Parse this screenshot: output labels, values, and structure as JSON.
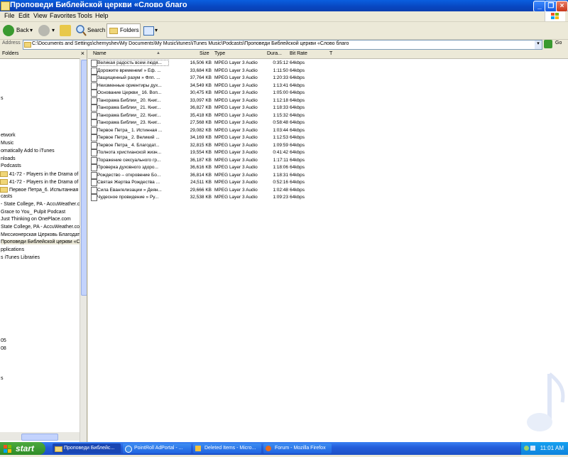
{
  "window": {
    "title": "Проповеди Библейской церкви «Слово благо"
  },
  "menu": [
    "File",
    "Edit",
    "View",
    "Favorites",
    "Tools",
    "Help"
  ],
  "toolbar": {
    "back": "Back",
    "search": "Search",
    "folders": "Folders"
  },
  "address": {
    "label": "Address",
    "path": "C:\\Documents and Settings\\chernyshev\\My Documents\\My Music\\itunes\\iTunes Music\\Podcasts\\Проповеди Библейской церкви «Слово благо",
    "go": "Go"
  },
  "folders_pane": {
    "title": "Folders",
    "items": [
      {
        "label": "s",
        "folder": false
      },
      {
        "label": "etwork",
        "folder": false
      },
      {
        "label": "Music",
        "folder": false
      },
      {
        "label": "omatically Add to iTunes",
        "folder": false
      },
      {
        "label": "nloads",
        "folder": false
      },
      {
        "label": "Podcasts",
        "folder": false
      },
      {
        "label": "41-72 - Players in the Drama of t",
        "folder": true
      },
      {
        "label": "41-72 - Players in the Drama of t",
        "folder": true
      },
      {
        "label": "Первое Петра_6. Испытанная",
        "folder": true
      },
      {
        "label": "casts",
        "folder": false
      },
      {
        "label": "- State College, PA - AccuWeather.co",
        "folder": false
      },
      {
        "label": "Grace to You_ Pulpit Podcast",
        "folder": false
      },
      {
        "label": "Just Thinking on OnePlace.com",
        "folder": false
      },
      {
        "label": "State College, PA - AccuWeather.com",
        "folder": false
      },
      {
        "label": "Миссионерская Церковь Благодат",
        "folder": false
      },
      {
        "label": "Проповеди Библейской церкви «Сл",
        "folder": false
      },
      {
        "label": "pplications",
        "folder": false
      },
      {
        "label": "s iTunes Libraries",
        "folder": false
      },
      {
        "label": "05",
        "folder": false
      },
      {
        "label": "08",
        "folder": false
      },
      {
        "label": "s",
        "folder": false
      }
    ]
  },
  "columns": [
    "Name",
    "Size",
    "Type",
    "Dura...",
    "Bit Rate",
    "T"
  ],
  "files": [
    {
      "name": "Великая радость всем людя...",
      "size": "16,506 KB",
      "type": "MPEG Layer 3 Audio",
      "duration": "0:35:12",
      "bitrate": "64kbps"
    },
    {
      "name": "Дорожите временем! » Еф. ...",
      "size": "33,684 KB",
      "type": "MPEG Layer 3 Audio",
      "duration": "1:11:50",
      "bitrate": "64kbps"
    },
    {
      "name": "Защищенный разум » Флп. ...",
      "size": "37,764 KB",
      "type": "MPEG Layer 3 Audio",
      "duration": "1:20:33",
      "bitrate": "64kbps"
    },
    {
      "name": "Неизменные ориентиры дух...",
      "size": "34,549 KB",
      "type": "MPEG Layer 3 Audio",
      "duration": "1:13:41",
      "bitrate": "64kbps"
    },
    {
      "name": "Основание Церкви_ 16. Воп...",
      "size": "30,475 KB",
      "type": "MPEG Layer 3 Audio",
      "duration": "1:05:00",
      "bitrate": "64kbps"
    },
    {
      "name": "Панорама Библии_ 20. Книг...",
      "size": "33,097 KB",
      "type": "MPEG Layer 3 Audio",
      "duration": "1:12:18",
      "bitrate": "64kbps"
    },
    {
      "name": "Панорама Библии_ 21. Книг...",
      "size": "36,827 KB",
      "type": "MPEG Layer 3 Audio",
      "duration": "1:18:33",
      "bitrate": "64kbps"
    },
    {
      "name": "Панорама Библии_ 22. Книг...",
      "size": "35,418 KB",
      "type": "MPEG Layer 3 Audio",
      "duration": "1:15:32",
      "bitrate": "64kbps"
    },
    {
      "name": "Панорама Библии_ 23. Книг...",
      "size": "27,568 KB",
      "type": "MPEG Layer 3 Audio",
      "duration": "0:58:48",
      "bitrate": "64kbps"
    },
    {
      "name": "Первое Петра_ 1. Истинная ...",
      "size": "29,082 KB",
      "type": "MPEG Layer 3 Audio",
      "duration": "1:03:44",
      "bitrate": "64kbps"
    },
    {
      "name": "Первое Петра_ 2. Великий ...",
      "size": "34,169 KB",
      "type": "MPEG Layer 3 Audio",
      "duration": "1:12:53",
      "bitrate": "64kbps"
    },
    {
      "name": "Первое Петра_ 4. Благодат...",
      "size": "32,815 KB",
      "type": "MPEG Layer 3 Audio",
      "duration": "1:09:59",
      "bitrate": "64kbps"
    },
    {
      "name": "Полнота христианской жизн...",
      "size": "19,554 KB",
      "type": "MPEG Layer 3 Audio",
      "duration": "0:41:42",
      "bitrate": "64kbps"
    },
    {
      "name": "Поражение сексуального гр...",
      "size": "36,187 KB",
      "type": "MPEG Layer 3 Audio",
      "duration": "1:17:11",
      "bitrate": "64kbps"
    },
    {
      "name": "Проверка духовного здоро...",
      "size": "36,616 KB",
      "type": "MPEG Layer 3 Audio",
      "duration": "1:18:06",
      "bitrate": "64kbps"
    },
    {
      "name": "Рождество – откровение Бо...",
      "size": "36,814 KB",
      "type": "MPEG Layer 3 Audio",
      "duration": "1:18:31",
      "bitrate": "64kbps"
    },
    {
      "name": "Святая Жертва Рождества ...",
      "size": "24,511 KB",
      "type": "MPEG Layer 3 Audio",
      "duration": "0:52:16",
      "bitrate": "64kbps"
    },
    {
      "name": "Сила Евангелизации » Деян...",
      "size": "29,666 KB",
      "type": "MPEG Layer 3 Audio",
      "duration": "1:02:48",
      "bitrate": "64kbps"
    },
    {
      "name": "Чудесное провидение » Ру...",
      "size": "32,538 KB",
      "type": "MPEG Layer 3 Audio",
      "duration": "1:09:23",
      "bitrate": "64kbps"
    }
  ],
  "taskbar": {
    "start": "start",
    "tasks": [
      "Проповеди Библейс...",
      "PointRoll AdPortal - ...",
      "Deleted Items - Micro...",
      "Forum - Mozilla Firefox"
    ],
    "clock": "11:01 AM"
  },
  "colors": {
    "titlebar": "#0a5fe0",
    "taskbar": "#245edb",
    "start": "#3a9a30"
  }
}
